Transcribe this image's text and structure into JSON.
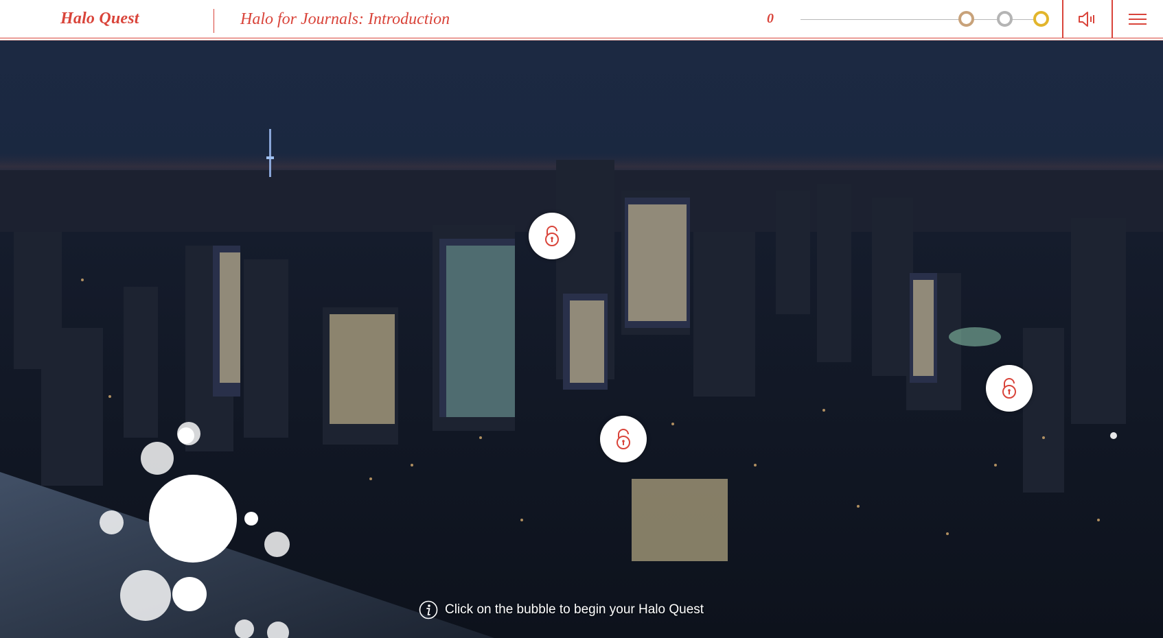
{
  "header": {
    "brand": "Halo Quest",
    "module_title": "Halo for Journals: Introduction",
    "score": "0",
    "progress_rings": [
      "bronze",
      "silver",
      "gold"
    ],
    "sound_icon": "speaker-icon",
    "menu_icon": "hamburger-menu-icon"
  },
  "scene": {
    "background": "night city skyline",
    "lock_icon": "padlock-icon",
    "locked_bubbles": 3,
    "start_bubble": "start-bubble"
  },
  "hint": {
    "icon": "info-icon",
    "text": "Click on the bubble to begin your Halo Quest"
  },
  "colors": {
    "accent": "#d9443a",
    "bronze": "#c8a27a",
    "silver": "#b4b4b4",
    "gold": "#e2b52c"
  }
}
